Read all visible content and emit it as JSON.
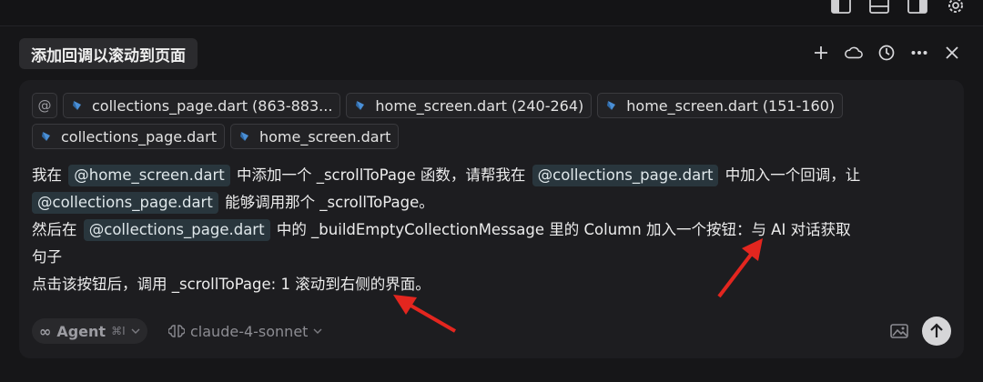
{
  "header": {
    "title": "添加回调以滚动到页面"
  },
  "context_chips": [
    {
      "label": "@"
    },
    {
      "label": "collections_page.dart (863-883..."
    },
    {
      "label": "home_screen.dart (240-264)"
    },
    {
      "label": "home_screen.dart (151-160)"
    },
    {
      "label": "collections_page.dart"
    },
    {
      "label": "home_screen.dart"
    }
  ],
  "message": {
    "l1_a": "我在",
    "l1_m1": "@home_screen.dart",
    "l1_b": "中添加一个 _scrollToPage 函数，请帮我在",
    "l1_m2": "@collections_page.dart",
    "l1_c": "中加入一个回调，让",
    "l2_m1": "@collections_page.dart",
    "l2_a": "能够调用那个 _scrollToPage。",
    "l3_a": "然后在",
    "l3_m1": "@collections_page.dart",
    "l3_b": "中的 _buildEmptyCollectionMessage 里的 Column 加入一个按钮：与 AI 对话获取",
    "l4": "句子",
    "l5": "点击该按钮后，调用 _scrollToPage: 1 滚动到右侧的界面。"
  },
  "footer": {
    "mode_label": "Agent",
    "mode_shortcut": "⌘I",
    "model_label": "claude-4-sonnet"
  },
  "icons": {
    "top_bar": [
      "layout-sidebar-left-icon",
      "layout-panel-icon",
      "layout-sidebar-right-icon",
      "gear-icon"
    ],
    "header": [
      "plus-icon",
      "cloud-icon",
      "history-icon",
      "more-icon",
      "close-icon"
    ]
  },
  "colors": {
    "background": "#161618",
    "composer": "#1d1d20",
    "mention_bg": "#29363d",
    "annotation_arrow": "#e3261f"
  }
}
